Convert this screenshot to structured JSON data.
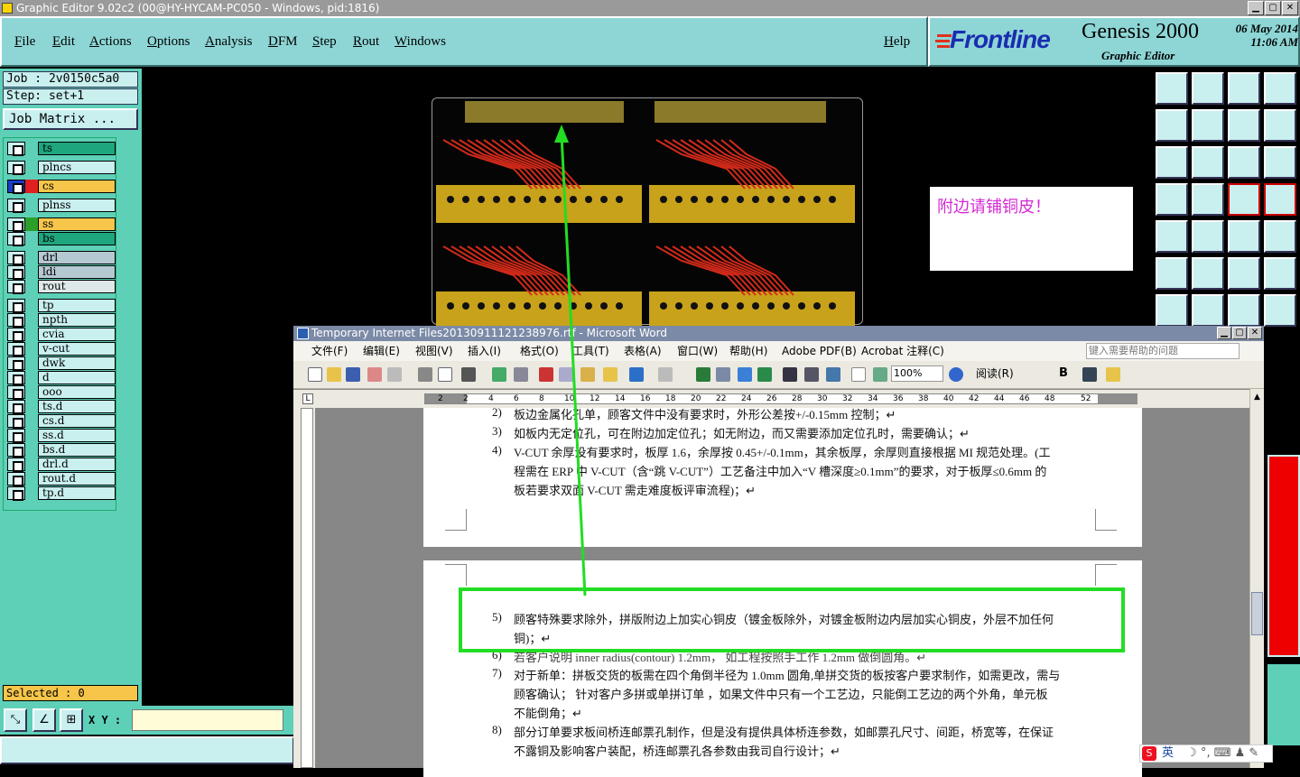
{
  "window": {
    "title": "Graphic Editor 9.02c2 (00@HY-HYCAM-PC050 - Windows, pid:1816)"
  },
  "menu": [
    "File",
    "Edit",
    "Actions",
    "Options",
    "Analysis",
    "DFM",
    "Step",
    "Rout",
    "Windows"
  ],
  "menu_help": "Help",
  "brand": {
    "logo": "Frontline",
    "product": "Genesis 2000",
    "subtitle": "Graphic Editor",
    "date": "06 May 2014",
    "time": "11:06 AM"
  },
  "job": {
    "job": "Job : 2v0150c5a0",
    "step": "Step: set+1",
    "matrix": "Job Matrix ..."
  },
  "layers": [
    {
      "name": "ts",
      "color": "#1ea67e"
    },
    {
      "name": "plncs",
      "color": "#c9efef"
    },
    {
      "name": "cs",
      "color": "#f6c54a"
    },
    {
      "name": "plnss",
      "color": "#c9efef"
    },
    {
      "name": "ss",
      "color": "#f6c54a"
    },
    {
      "name": "bs",
      "color": "#1ea67e"
    },
    {
      "name": "drl",
      "color": "#b5c9d2"
    },
    {
      "name": "ldi",
      "color": "#b5c9d2"
    },
    {
      "name": "rout",
      "color": "#dfe8e8"
    },
    {
      "name": "tp",
      "color": "#c9efef"
    },
    {
      "name": "npth",
      "color": "#c9efef"
    },
    {
      "name": "cvia",
      "color": "#c9efef"
    },
    {
      "name": "v-cut",
      "color": "#c9efef"
    },
    {
      "name": "dwk",
      "color": "#c9efef"
    },
    {
      "name": "d",
      "color": "#c9efef"
    },
    {
      "name": "ooo",
      "color": "#c9efef"
    },
    {
      "name": "ts.d",
      "color": "#c9efef"
    },
    {
      "name": "cs.d",
      "color": "#c9efef"
    },
    {
      "name": "ss.d",
      "color": "#c9efef"
    },
    {
      "name": "bs.d",
      "color": "#c9efef"
    },
    {
      "name": "drl.d",
      "color": "#c9efef"
    },
    {
      "name": "rout.d",
      "color": "#c9efef"
    },
    {
      "name": "tp.d",
      "color": "#c9efef"
    }
  ],
  "selected": "Selected : 0",
  "xy_label": "X Y :",
  "note": "附边请铺铜皮！",
  "word": {
    "title": "Temporary Internet Files20130911121238976.rtf - Microsoft Word",
    "menu": [
      "文件(F)",
      "编辑(E)",
      "视图(V)",
      "插入(I)",
      "格式(O)",
      "工具(T)",
      "表格(A)",
      "窗口(W)",
      "帮助(H)",
      "Adobe PDF(B)",
      "Acrobat 注释(C)"
    ],
    "help_placeholder": "键入需要帮助的问题",
    "zoom": "100%",
    "read": "阅读(R)",
    "ruler_ticks": [
      "2",
      "2",
      "4",
      "6",
      "8",
      "10",
      "12",
      "14",
      "16",
      "18",
      "20",
      "22",
      "24",
      "26",
      "28",
      "30",
      "32",
      "34",
      "36",
      "38",
      "40",
      "42",
      "44",
      "46",
      "48",
      "52"
    ],
    "page1": [
      {
        "num": "2)",
        "text": "板边金属化孔单，顾客文件中没有要求时，外形公差按+/-0.15mm 控制；↵"
      },
      {
        "num": "3)",
        "text": "如板内无定位孔，可在附边加定位孔；如无附边，而又需要添加定位孔时，需要确认；↵"
      },
      {
        "num": "4)",
        "text": "V-CUT 余厚没有要求时，板厚 1.6，余厚按 0.45+/-0.1mm，其余板厚，余厚则直接根据 MI 规范处理。(工"
      },
      {
        "num": "",
        "text": "程需在 ERP 中 V-CUT（含“跳 V-CUT”）工艺备注中加入“V 槽深度≥0.1mm”的要求，对于板厚≤0.6mm 的"
      },
      {
        "num": "",
        "text": "板若要求双面 V-CUT 需走难度板评审流程)；↵"
      }
    ],
    "page2": [
      {
        "num": "5)",
        "text": "顾客特殊要求除外，拼版附边上加实心铜皮（镀金板除外，对镀金板附边内层加实心铜皮，外层不加任何"
      },
      {
        "num": "",
        "text": "铜)；↵"
      },
      {
        "num": "6)",
        "text": "若客户说明 inner radius(contour) 1.2mm，  如工程按照手工作 1.2mm 做倒圆角。↵"
      },
      {
        "num": "7)",
        "text": "对于新单：拼板交货的板需在四个角倒半径为 1.0mm 圆角,单拼交货的板按客户要求制作，如需更改，需与"
      },
      {
        "num": "",
        "text": "顾客确认；  针对客户多拼或单拼订单 ，如果文件中只有一个工艺边，只能倒工艺边的两个外角，单元板"
      },
      {
        "num": "",
        "text": "不能倒角；↵"
      },
      {
        "num": "8)",
        "text": "部分订单要求板间桥连邮票孔制作，但是没有提供具体桥连参数，如邮票孔尺寸、间距，桥宽等，在保证"
      },
      {
        "num": "",
        "text": "不露铜及影响客户装配，桥连邮票孔各参数由我司自行设计；↵"
      }
    ]
  },
  "ime": "英",
  "colors": {
    "teal": "#8ed6d6",
    "panel": "#5ed0b8",
    "highlight": "#22dd22",
    "copper": "#c8a21a",
    "trace": "#d42a1a"
  }
}
